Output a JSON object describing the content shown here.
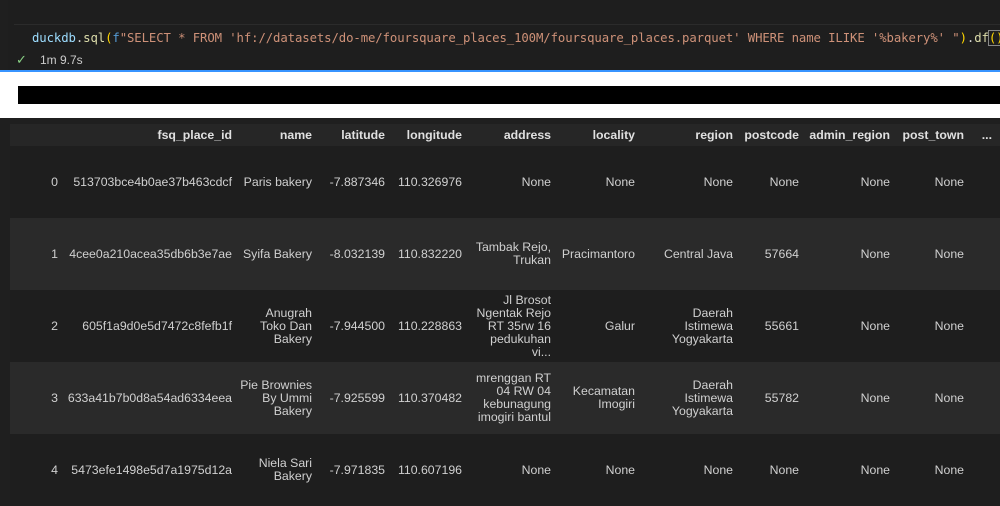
{
  "code": {
    "fn": "duckdb",
    "dot1": ".",
    "method": "sql",
    "open": "(",
    "prefix": "f",
    "query": "\"SELECT * FROM 'hf://datasets/do-me/foursquare_places_100M/foursquare_places.parquet' WHERE name ILIKE '%bakery%' \"",
    "close": ")",
    "dot2": ".",
    "df": "df",
    "parens": "()"
  },
  "status": {
    "check": "✓",
    "duration": "1m 9.7s"
  },
  "table": {
    "columns": [
      "fsq_place_id",
      "name",
      "latitude",
      "longitude",
      "address",
      "locality",
      "region",
      "postcode",
      "admin_region",
      "post_town",
      "..."
    ],
    "rows": [
      {
        "idx": "0",
        "fsq_place_id": "513703bce4b0ae37b463cdcf",
        "name": [
          "Paris bakery"
        ],
        "latitude": "-7.887346",
        "longitude": "110.326976",
        "address": [
          "None"
        ],
        "locality": [
          "None"
        ],
        "region": [
          "None"
        ],
        "postcode": "None",
        "admin_region": "None",
        "post_town": "None"
      },
      {
        "idx": "1",
        "fsq_place_id": "4cee0a210acea35db6b3e7ae",
        "name": [
          "Syifa Bakery"
        ],
        "latitude": "-8.032139",
        "longitude": "110.832220",
        "address": [
          "Tambak Rejo,",
          "Trukan"
        ],
        "locality": [
          "Pracimantoro"
        ],
        "region": [
          "Central Java"
        ],
        "postcode": "57664",
        "admin_region": "None",
        "post_town": "None"
      },
      {
        "idx": "2",
        "fsq_place_id": "605f1a9d0e5d7472c8fefb1f",
        "name": [
          "Anugrah",
          "Toko Dan",
          "Bakery"
        ],
        "latitude": "-7.944500",
        "longitude": "110.228863",
        "address": [
          "Jl Brosot",
          "Ngentak Rejo",
          "RT 35rw 16",
          "pedukuhan",
          "vi..."
        ],
        "locality": [
          "Galur"
        ],
        "region": [
          "Daerah",
          "Istimewa",
          "Yogyakarta"
        ],
        "postcode": "55661",
        "admin_region": "None",
        "post_town": "None"
      },
      {
        "idx": "3",
        "fsq_place_id": "633a41b7b0d8a54ad6334eea",
        "name": [
          "Pie Brownies",
          "By Ummi",
          "Bakery"
        ],
        "latitude": "-7.925599",
        "longitude": "110.370482",
        "address": [
          "mrenggan RT",
          "04 RW 04",
          "kebunagung",
          "imogiri bantul"
        ],
        "locality": [
          "Kecamatan",
          "Imogiri"
        ],
        "region": [
          "Daerah",
          "Istimewa",
          "Yogyakarta"
        ],
        "postcode": "55782",
        "admin_region": "None",
        "post_town": "None"
      },
      {
        "idx": "4",
        "fsq_place_id": "5473efe1498e5d7a1975d12a",
        "name": [
          "Niela Sari",
          "Bakery"
        ],
        "latitude": "-7.971835",
        "longitude": "110.607196",
        "address": [
          "None"
        ],
        "locality": [
          "None"
        ],
        "region": [
          "None"
        ],
        "postcode": "None",
        "admin_region": "None",
        "post_town": "None"
      }
    ]
  }
}
